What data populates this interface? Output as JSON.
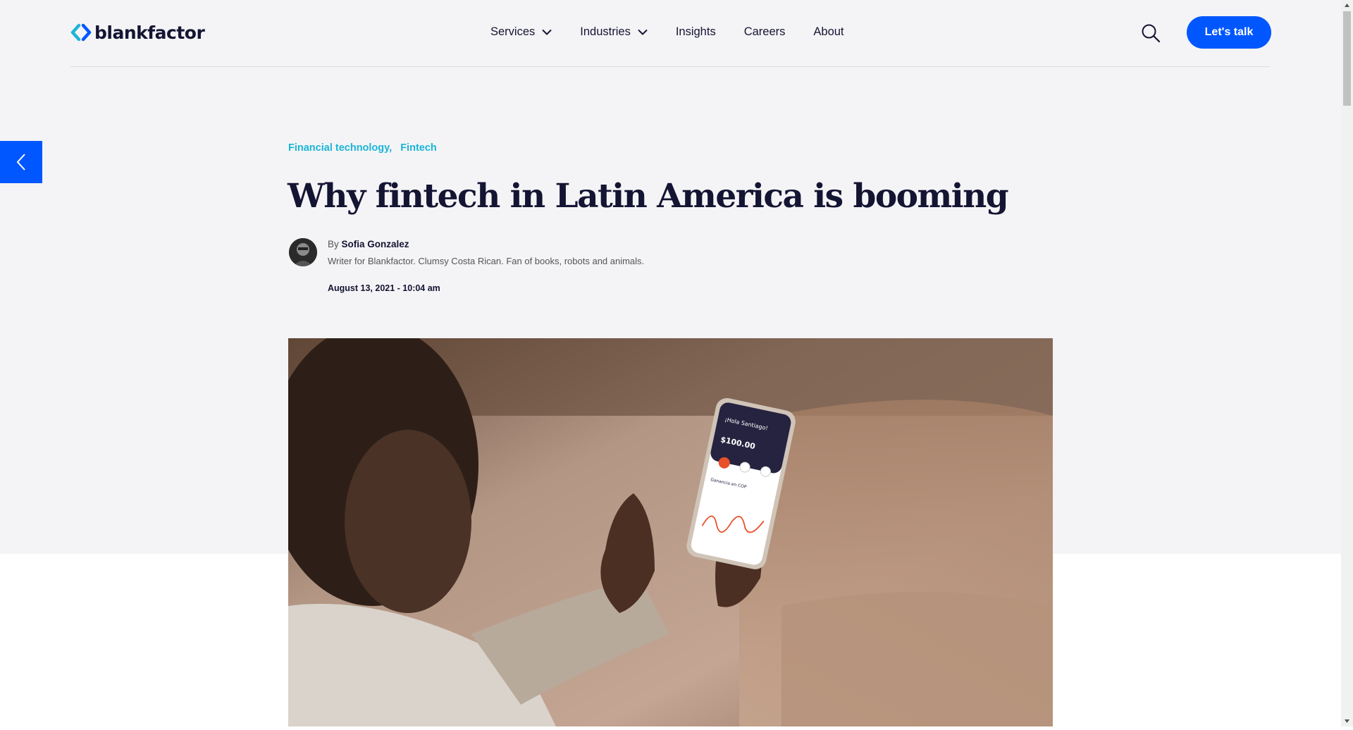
{
  "brand": {
    "name": "blankfactor",
    "accent": "#0057ff",
    "logo_color": "#1ab5d6"
  },
  "nav": {
    "items": [
      {
        "label": "Services",
        "has_dropdown": true
      },
      {
        "label": "Industries",
        "has_dropdown": true
      },
      {
        "label": "Insights",
        "has_dropdown": false
      },
      {
        "label": "Careers",
        "has_dropdown": false
      },
      {
        "label": "About",
        "has_dropdown": false
      }
    ],
    "search_icon": "search-icon",
    "cta_label": "Let's talk"
  },
  "back_icon": "chevron-left-icon",
  "article": {
    "categories": [
      "Financial technology,",
      "Fintech"
    ],
    "title": "Why fintech in Latin America is booming",
    "author": {
      "by": "By",
      "name": "Sofia Gonzalez",
      "bio": "Writer for Blankfactor. Clumsy Costa Rican. Fan of books, robots and animals."
    },
    "date": "August 13, 2021 - 10:04 am",
    "hero_phone": {
      "greeting": "¡Hola Santiago!",
      "balance": "$100.00",
      "section": "Ganancia en COP"
    }
  }
}
